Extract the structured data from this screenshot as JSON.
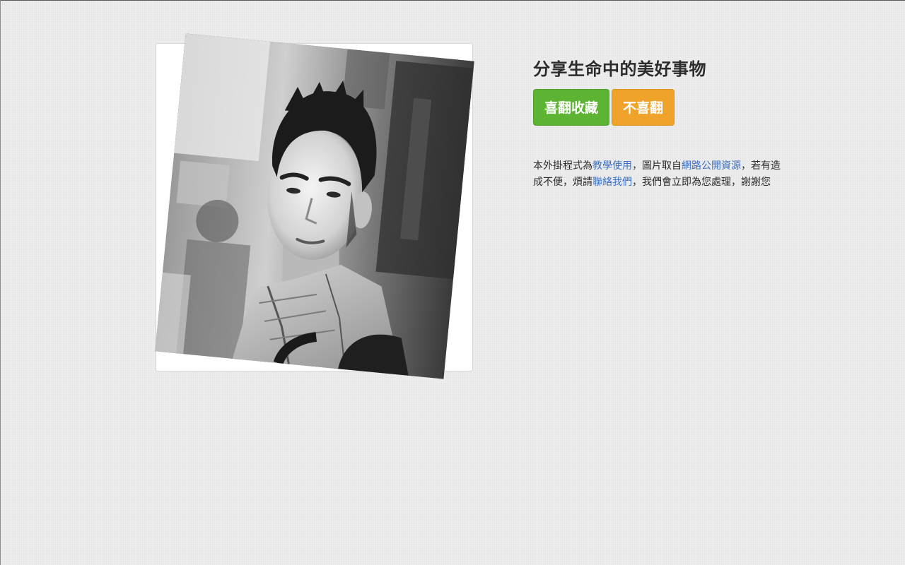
{
  "headline": "分享生命中的美好事物",
  "buttons": {
    "like_label": "喜翻收藏",
    "dislike_label": "不喜翻"
  },
  "notice": {
    "part1": "本外掛程式為",
    "link_teaching": "教學使用",
    "part2": "，圖片取自",
    "link_source": "網路公開資源",
    "part3": "，若有造成不便，煩請",
    "link_contact": "聯絡我們",
    "part4": "，我們會立即為您處理，謝謝您"
  },
  "photo": {
    "description_icon": "portrait-photo",
    "style": "black-and-white"
  },
  "colors": {
    "like_button": "#5cb432",
    "dislike_button": "#f0a32a",
    "link": "#3a6fc4",
    "background": "#ebebeb"
  }
}
